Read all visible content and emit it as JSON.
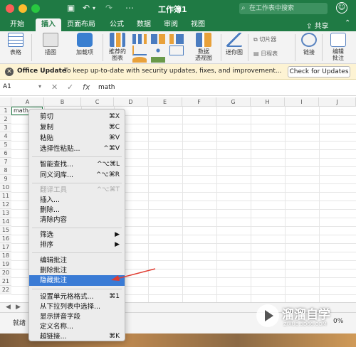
{
  "window": {
    "title": "工作簿1",
    "search_placeholder": "在工作表中搜索"
  },
  "ribbon_tabs": [
    "开始",
    "插入",
    "页面布局",
    "公式",
    "数据",
    "审阅",
    "视图"
  ],
  "active_tab": "插入",
  "share_label": "共享",
  "ribbon": {
    "table": "表格",
    "illustrations": "插图",
    "addins": "加载项",
    "recommended_charts_1": "推荐的",
    "recommended_charts_2": "图表",
    "pivot_chart_1": "数据",
    "pivot_chart_2": "透视图",
    "sparklines": "迷你图",
    "slicer": "切片器",
    "timeline": "日程表",
    "link": "链接",
    "comment_1": "编辑",
    "comment_2": "批注"
  },
  "update_bar": {
    "title": "Office Update",
    "message": "To keep up-to-date with security updates, fixes, and improvement...",
    "button": "Check for Updates"
  },
  "formula_bar": {
    "name_box": "A1",
    "cancel_icon": "✕",
    "enter_icon": "✓",
    "fx": "fx",
    "value": "math"
  },
  "columns": [
    "A",
    "B",
    "C",
    "D",
    "E",
    "F",
    "G",
    "H",
    "I",
    "J"
  ],
  "rows": [
    "1",
    "2",
    "3",
    "4",
    "5",
    "6",
    "7",
    "8",
    "9",
    "10",
    "11",
    "12",
    "13",
    "14",
    "15",
    "16",
    "17",
    "18",
    "19",
    "20",
    "21",
    "22"
  ],
  "cell_a1": "math",
  "context_menu": [
    {
      "label": "剪切",
      "shortcut": "⌘X",
      "state": "normal"
    },
    {
      "label": "复制",
      "shortcut": "⌘C",
      "state": "normal"
    },
    {
      "label": "粘贴",
      "shortcut": "⌘V",
      "state": "normal"
    },
    {
      "label": "选择性粘贴...",
      "shortcut": "^⌘V",
      "state": "normal"
    },
    {
      "sep": true
    },
    {
      "label": "智能查找...",
      "shortcut": "^⌥⌘L",
      "state": "normal"
    },
    {
      "label": "同义词库...",
      "shortcut": "^⌥⌘R",
      "state": "normal"
    },
    {
      "sep": true
    },
    {
      "label": "翻译工具",
      "shortcut": "^⌥⌘T",
      "state": "disabled"
    },
    {
      "label": "插入...",
      "shortcut": "",
      "state": "normal"
    },
    {
      "label": "删除...",
      "shortcut": "",
      "state": "normal"
    },
    {
      "label": "清除内容",
      "shortcut": "",
      "state": "normal"
    },
    {
      "sep": true
    },
    {
      "label": "筛选",
      "shortcut": "▶",
      "state": "normal"
    },
    {
      "label": "排序",
      "shortcut": "▶",
      "state": "normal"
    },
    {
      "sep": true
    },
    {
      "label": "编辑批注",
      "shortcut": "",
      "state": "normal"
    },
    {
      "label": "删除批注",
      "shortcut": "",
      "state": "normal"
    },
    {
      "label": "隐藏批注",
      "shortcut": "",
      "state": "highlighted"
    },
    {
      "sep": true
    },
    {
      "label": "设置单元格格式...",
      "shortcut": "⌘1",
      "state": "normal"
    },
    {
      "label": "从下拉列表中选择...",
      "shortcut": "",
      "state": "normal"
    },
    {
      "label": "显示拼音字段",
      "shortcut": "",
      "state": "normal"
    },
    {
      "label": "定义名称...",
      "shortcut": "",
      "state": "normal"
    },
    {
      "label": "超链接...",
      "shortcut": "⌘K",
      "state": "normal"
    }
  ],
  "status": {
    "text": "就绪",
    "zoom": "0%"
  },
  "watermark": {
    "text": "溜溜自学",
    "sub": "ZIXUE.3D66.COM"
  },
  "colors": {
    "excel_green": "#1f7a44",
    "menu_highlight": "#3a7bd5",
    "arrow_red": "#e03c31"
  }
}
